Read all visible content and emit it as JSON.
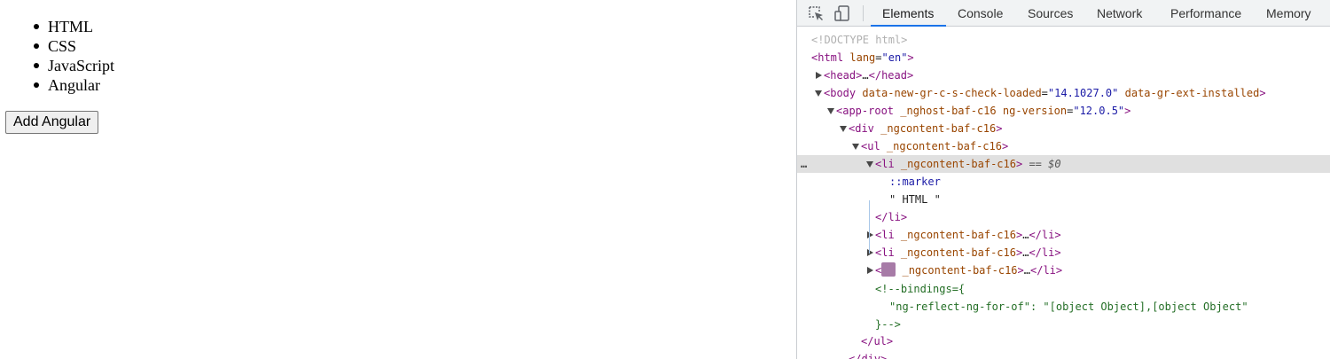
{
  "page": {
    "list_items": [
      "HTML",
      "CSS",
      "JavaScript",
      "Angular"
    ],
    "add_button_label": "Add Angular"
  },
  "devtools": {
    "toolbar_icons": [
      "inspect-element-icon",
      "device-toolbar-icon"
    ],
    "tabs": [
      {
        "label": "Elements",
        "active": true
      },
      {
        "label": "Console",
        "active": false
      },
      {
        "label": "Sources",
        "active": false
      },
      {
        "label": "Network",
        "active": false
      },
      {
        "label": "Performance",
        "active": false
      },
      {
        "label": "Memory",
        "active": false
      }
    ],
    "accent_color": "#1a73e8",
    "dom": {
      "doctype": "<!DOCTYPE html>",
      "html_tag": "html",
      "html_attr": "lang",
      "html_val": "\"en\"",
      "head_tag": "head",
      "body_tag": "body",
      "body_attr1": "data-new-gr-c-s-check-loaded",
      "body_val1": "\"14.1027.0\"",
      "body_attr2": "data-gr-ext-installed",
      "approot_tag": "app-root",
      "approot_attr1": "_nghost-baf-c16",
      "approot_attr2": "ng-version",
      "approot_val2": "\"12.0.5\"",
      "div_tag": "div",
      "ngcontent_attr": "_ngcontent-baf-c16",
      "ul_tag": "ul",
      "li_tag": "li",
      "selected_marker": "== $0",
      "marker_pseudo": "::marker",
      "text_node": "\" HTML \"",
      "ellipsis": "…",
      "comment_open": "<!--bindings={",
      "comment_key": "\"ng-reflect-ng-for-of\": \"[object Object],[object Object\"",
      "comment_close": "}-->",
      "row_menu": "…"
    }
  }
}
